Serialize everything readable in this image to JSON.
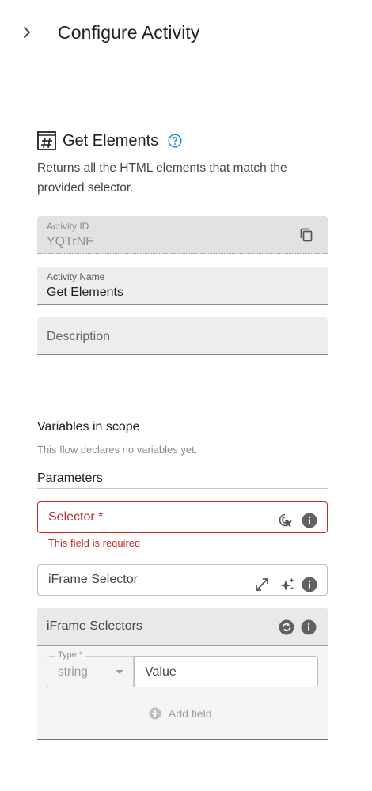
{
  "header": {
    "title": "Configure Activity",
    "chevron_icon": "chevron-right-icon"
  },
  "activity": {
    "icon": "hash-selector-icon",
    "title": "Get Elements",
    "help_icon": "help-icon",
    "description": "Returns all the HTML elements that match the provided selector."
  },
  "fields": {
    "activity_id": {
      "label": "Activity ID",
      "value": "YQTrNF",
      "icon": "copy-icon"
    },
    "activity_name": {
      "label": "Activity Name",
      "value": "Get Elements"
    },
    "description": {
      "placeholder": "Description"
    }
  },
  "variables": {
    "title": "Variables in scope",
    "empty_text": "This flow declares no variables yet."
  },
  "parameters": {
    "title": "Parameters",
    "selector": {
      "placeholder": "Selector *",
      "error": "This field is required"
    },
    "iframe_selector": {
      "placeholder": "iFrame Selector"
    },
    "iframe_selectors": {
      "title": "iFrame Selectors",
      "type_label": "Type *",
      "type_value": "string",
      "value_placeholder": "Value",
      "add_field_label": "Add field"
    }
  },
  "colors": {
    "error": "#c62828",
    "help": "#1e88e5",
    "field_bg": "#ededed"
  }
}
